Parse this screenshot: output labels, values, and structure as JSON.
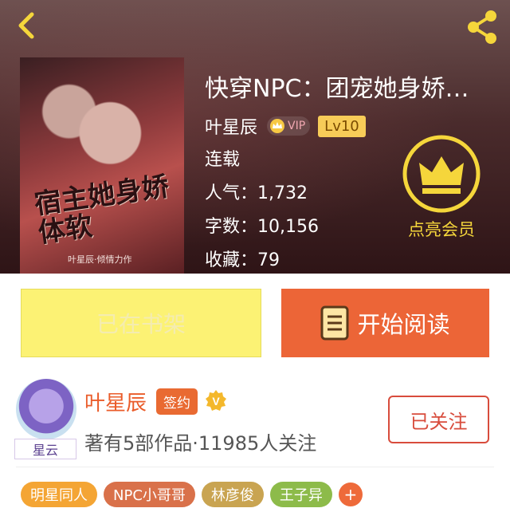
{
  "book": {
    "title": "快穿NPC：团宠她身娇…",
    "author": "叶星辰",
    "vip_label": "VIP",
    "level": "Lv10",
    "status": "连载",
    "popularity": "人气：1,732",
    "word_count": "字数：10,156",
    "favorites": "收藏：79",
    "cover_title": "宿主她身娇体软",
    "cover_author": "叶星辰·倾情力作"
  },
  "vip_member": {
    "label": "点亮会员"
  },
  "actions": {
    "shelf_label": "已在书架",
    "read_label": "开始阅读"
  },
  "writer": {
    "name": "叶星辰",
    "signed_badge": "签约",
    "meta": "著有5部作品·11985人关注",
    "follow_label": "已关注",
    "avatar_tag": "星云"
  },
  "tags": [
    {
      "label": "明星同人",
      "color": "#f4a534"
    },
    {
      "label": "NPC小哥哥",
      "color": "#d9714a"
    },
    {
      "label": "林彦俊",
      "color": "#c9a451"
    },
    {
      "label": "王子异",
      "color": "#8dbb4a"
    }
  ],
  "tag_more_label": "+",
  "colors": {
    "accent": "#ec6537",
    "shelf": "#fcf274",
    "gold": "#f5d63b"
  }
}
